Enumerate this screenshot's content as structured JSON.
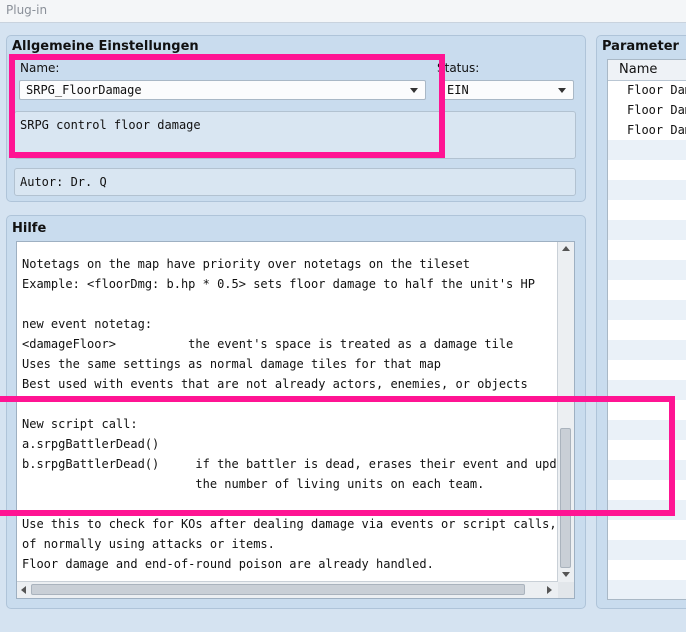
{
  "window": {
    "title": "Plug-in"
  },
  "general": {
    "title": "Allgemeine Einstellungen",
    "name_label": "Name:",
    "name_value": "SRPG_FloorDamage",
    "status_label": "Status:",
    "status_value": "EIN",
    "description": "SRPG control floor damage",
    "author": "Autor: Dr. Q"
  },
  "help": {
    "title": "Hilfe",
    "text": "Notetags on the map have priority over notetags on the tileset\nExample: <floorDmg: b.hp * 0.5> sets floor damage to half the unit's HP\n\nnew event notetag:\n<damageFloor>          the event's space is treated as a damage tile\nUses the same settings as normal damage tiles for that map\nBest used with events that are not already actors, enemies, or objects\n\nNew script call:\na.srpgBattlerDead()\nb.srpgBattlerDead()     if the battler is dead, erases their event and updates\n                        the number of living units on each team.\n\nUse this to check for KOs after dealing damage via events or script calls, outside\nof normally using attacks or items.\nFloor damage and end-of-round poison are already handled."
  },
  "parameters": {
    "title": "Parameter",
    "column_header": "Name",
    "items": [
      "Floor Damage",
      "Floor Damage",
      "Floor Damage"
    ]
  },
  "colors": {
    "highlight": "#ff1493",
    "panel": "#c9dcee",
    "background": "#d5e3f1"
  }
}
